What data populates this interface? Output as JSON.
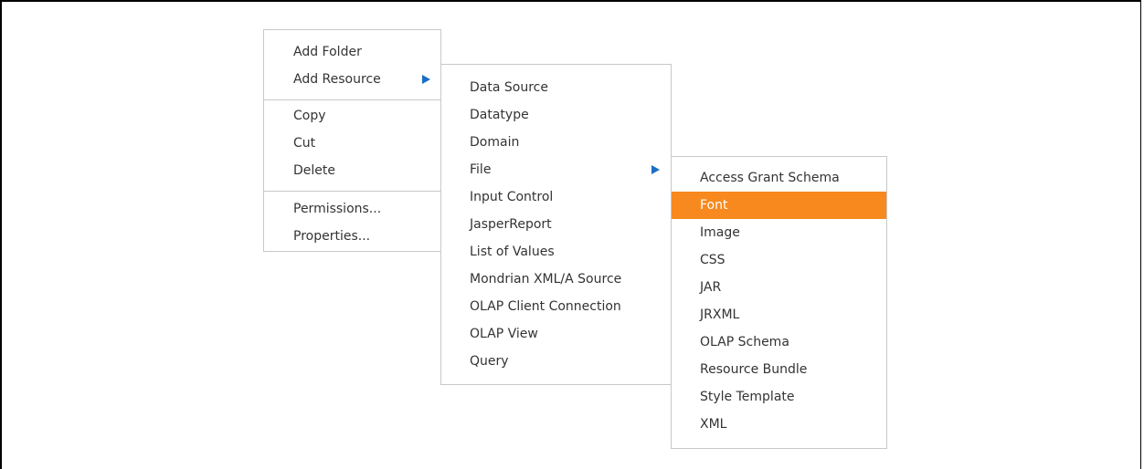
{
  "context_menu": {
    "groups": [
      [
        {
          "label": "Add Folder"
        },
        {
          "label": "Add Resource",
          "has_submenu": true
        }
      ],
      [
        {
          "label": "Copy"
        },
        {
          "label": "Cut"
        },
        {
          "label": "Delete"
        }
      ],
      [
        {
          "label": "Permissions..."
        },
        {
          "label": "Properties..."
        }
      ]
    ]
  },
  "add_resource_menu": {
    "items": [
      {
        "label": "Data Source"
      },
      {
        "label": "Datatype"
      },
      {
        "label": "Domain"
      },
      {
        "label": "File",
        "has_submenu": true
      },
      {
        "label": "Input Control"
      },
      {
        "label": "JasperReport"
      },
      {
        "label": "List of Values"
      },
      {
        "label": "Mondrian XML/A Source"
      },
      {
        "label": "OLAP Client Connection"
      },
      {
        "label": "OLAP View"
      },
      {
        "label": "Query"
      }
    ]
  },
  "file_menu": {
    "items": [
      {
        "label": "Access Grant Schema"
      },
      {
        "label": "Font",
        "highlighted": true
      },
      {
        "label": "Image"
      },
      {
        "label": "CSS"
      },
      {
        "label": "JAR"
      },
      {
        "label": "JRXML"
      },
      {
        "label": "OLAP Schema"
      },
      {
        "label": "Resource Bundle"
      },
      {
        "label": "Style Template"
      },
      {
        "label": "XML"
      }
    ]
  },
  "colors": {
    "highlight": "#f7891f",
    "submenu_arrow": "#1a6ec4",
    "menu_border": "#c8c8c8",
    "text": "#333333"
  }
}
